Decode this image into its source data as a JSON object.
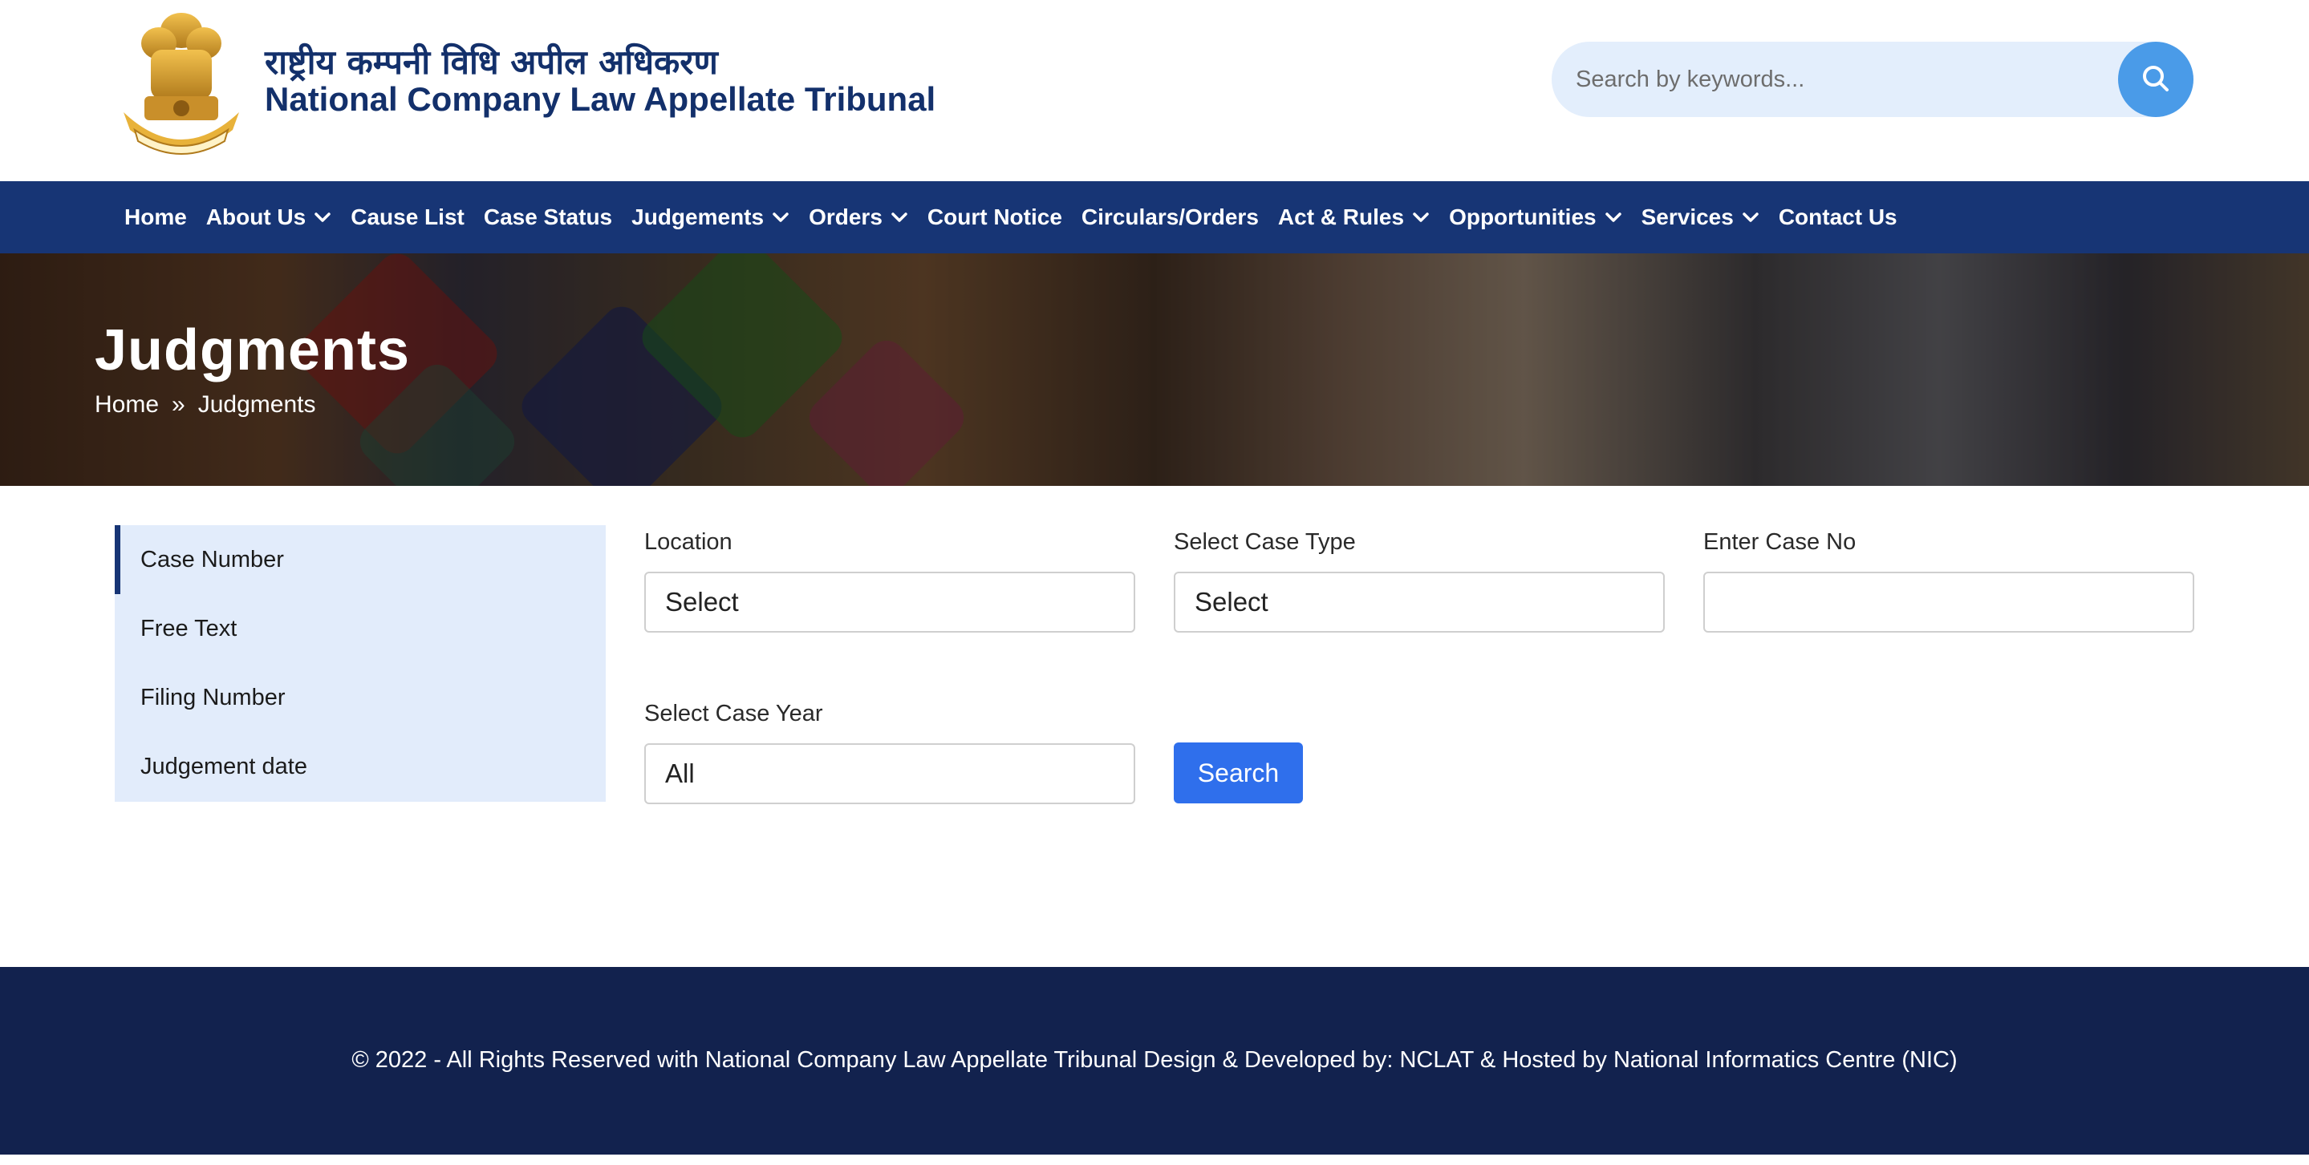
{
  "header": {
    "title_hindi": "राष्ट्रीय कम्पनी विधि अपील अधिकरण",
    "title_english": "National Company Law Appellate Tribunal",
    "search_placeholder": "Search by keywords..."
  },
  "nav": {
    "items": [
      {
        "label": "Home",
        "dropdown": false
      },
      {
        "label": "About Us",
        "dropdown": true
      },
      {
        "label": "Cause List",
        "dropdown": false
      },
      {
        "label": "Case Status",
        "dropdown": false
      },
      {
        "label": "Judgements",
        "dropdown": true
      },
      {
        "label": "Orders",
        "dropdown": true
      },
      {
        "label": "Court Notice",
        "dropdown": false
      },
      {
        "label": "Circulars/Orders",
        "dropdown": false
      },
      {
        "label": "Act & Rules",
        "dropdown": true
      },
      {
        "label": "Opportunities",
        "dropdown": true
      },
      {
        "label": "Services",
        "dropdown": true
      },
      {
        "label": "Contact Us",
        "dropdown": false
      }
    ]
  },
  "banner": {
    "title": "Judgments",
    "breadcrumb": {
      "home": "Home",
      "separator": "»",
      "current": "Judgments"
    }
  },
  "sidebar": {
    "items": [
      {
        "label": "Case Number",
        "active": true
      },
      {
        "label": "Free Text",
        "active": false
      },
      {
        "label": "Filing Number",
        "active": false
      },
      {
        "label": "Judgement date",
        "active": false
      }
    ]
  },
  "form": {
    "location": {
      "label": "Location",
      "value": "Select"
    },
    "case_type": {
      "label": "Select Case Type",
      "value": "Select"
    },
    "case_no": {
      "label": "Enter Case No",
      "value": ""
    },
    "case_year": {
      "label": "Select Case Year",
      "value": "All"
    },
    "search_label": "Search"
  },
  "footer": {
    "text": "© 2022 - All Rights Reserved with National Company Law Appellate Tribunal Design & Developed by: NCLAT & Hosted by National Informatics Centre (NIC)"
  },
  "colors": {
    "navy": "#173575",
    "footer": "#12224e",
    "accent_blue": "#2f6fec",
    "search_button": "#4a9be8",
    "sidebar_bg": "#e2ecfb"
  }
}
